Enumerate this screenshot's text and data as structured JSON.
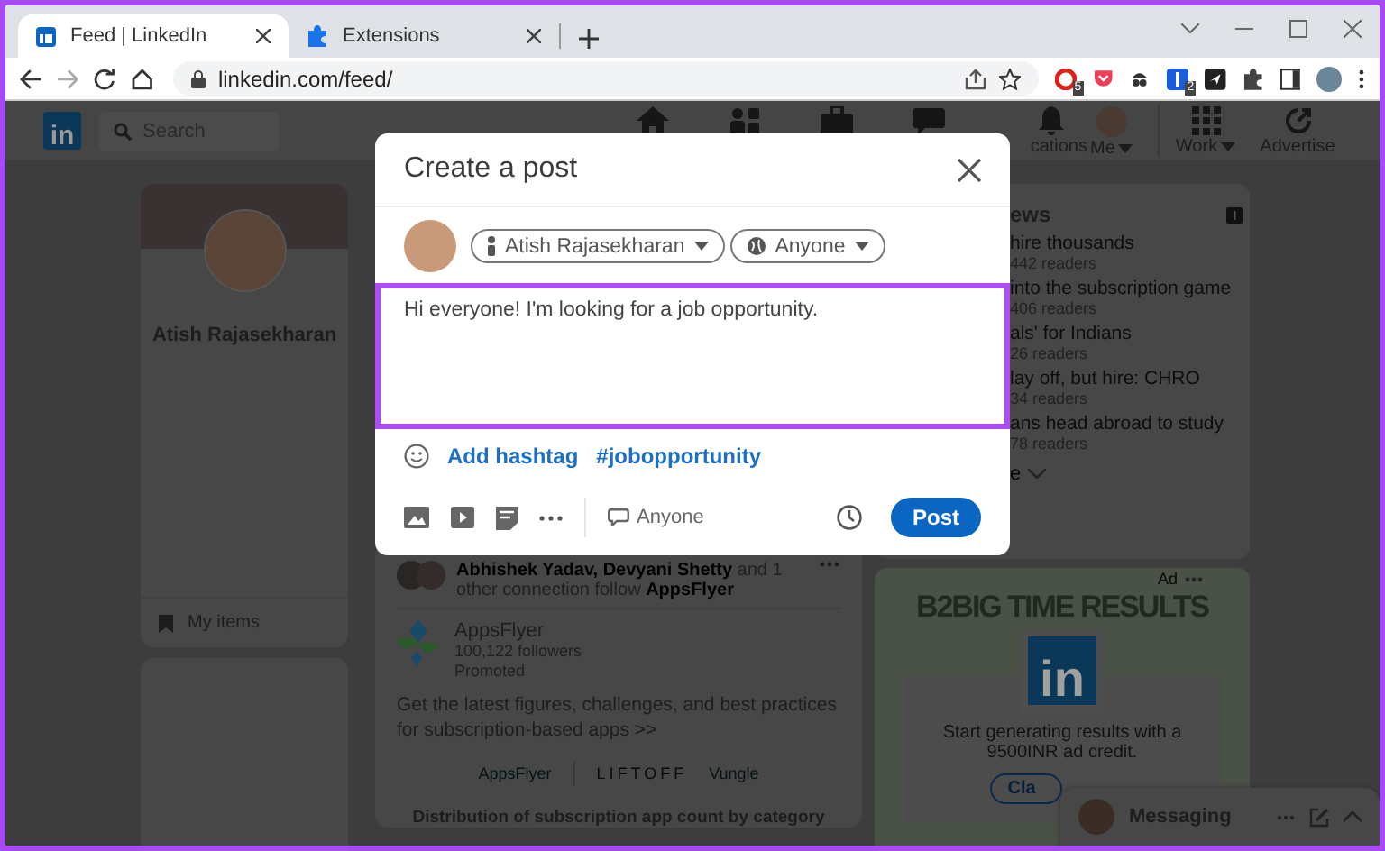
{
  "browser": {
    "tabs": [
      {
        "title": "Feed | LinkedIn",
        "kind": "site",
        "selected": true
      },
      {
        "title": "Extensions",
        "kind": "extensions",
        "selected": false
      }
    ],
    "url": "linkedin.com/feed/",
    "extension_badges": [
      "5",
      "2"
    ]
  },
  "nav": {
    "logo": "in",
    "search": {
      "placeholder": "Search"
    },
    "items": [
      {
        "kind": "home"
      },
      {
        "kind": "network"
      },
      {
        "kind": "jobs"
      },
      {
        "kind": "messaging"
      },
      {
        "kind": "notifications",
        "label": "cations"
      },
      {
        "kind": "me",
        "label": "Me"
      },
      {
        "kind": "work",
        "label": "Work"
      },
      {
        "kind": "advertise",
        "label": "Advertise"
      }
    ]
  },
  "profile": {
    "name": "Atish Rajasekharan",
    "my_items": "My items"
  },
  "feed_post": {
    "social_line": "**Abhishek Yadav, Devyani Shetty** and 1 other connection follow **AppsFlyer**",
    "company": "AppsFlyer",
    "followers": "100,122 followers",
    "promoted": "Promoted",
    "description": "Get the latest figures, challenges, and best practices for subscription-based apps >>",
    "partner_logos": [
      "AppsFlyer",
      "LIFTOFF",
      "Vungle"
    ],
    "chart_title": "Distribution of subscription app count by category"
  },
  "news": {
    "heading": "ews",
    "items": [
      {
        "title": "hire thousands",
        "readers": "442 readers"
      },
      {
        "title": "into the subscription game",
        "readers": "406 readers"
      },
      {
        "title": "als' for Indians",
        "readers": "26 readers"
      },
      {
        "title": "lay off, but hire: CHRO",
        "readers": "34 readers"
      },
      {
        "title": "ans head abroad to study",
        "readers": "78 readers"
      }
    ],
    "show_more": "e"
  },
  "ad": {
    "label": "Ad",
    "headline": "B2BIG TIME RESULTS",
    "logo": "in",
    "text": "Start generating results with a 9500INR ad credit.",
    "button": "Cla"
  },
  "messaging": {
    "title": "Messaging"
  },
  "composer": {
    "title": "Create a post",
    "author": "Atish Rajasekharan",
    "audience": "Anyone",
    "text": "Hi everyone! I'm looking for a job opportunity.",
    "add_hashtag": "Add hashtag",
    "hashtag": "#jobopportunity",
    "comment_setting": "Anyone",
    "post_button": "Post"
  }
}
